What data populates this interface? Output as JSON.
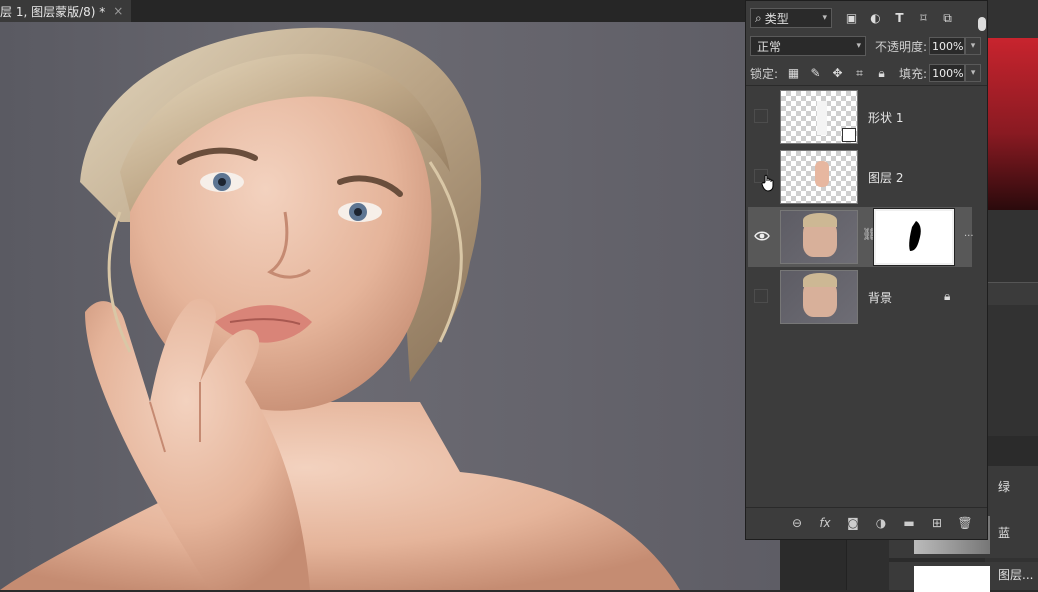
{
  "document": {
    "tab_title": "层 1, 图层蒙版/8) *",
    "close_glyph": "×"
  },
  "layers_panel": {
    "filter": {
      "label": "类型",
      "icon": "search-icon"
    },
    "filter_icons": [
      "image-filter-icon",
      "adjustment-filter-icon",
      "type-filter-icon",
      "shape-filter-icon",
      "smart-object-filter-icon"
    ],
    "blend_mode": "正常",
    "opacity_label": "不透明度:",
    "opacity_value": "100%",
    "lock_label": "锁定:",
    "lock_icons": [
      "lock-transparent-icon",
      "lock-paint-icon",
      "lock-position-icon",
      "lock-artboard-icon",
      "lock-all-icon"
    ],
    "fill_label": "填充:",
    "fill_value": "100%",
    "layers": [
      {
        "name": "形状 1",
        "visible": false,
        "type": "shape"
      },
      {
        "name": "图层 2",
        "visible": false,
        "type": "pixel"
      },
      {
        "name": "",
        "visible": true,
        "type": "masked",
        "selected": true
      },
      {
        "name": "背景",
        "visible": false,
        "type": "background",
        "locked": true
      }
    ],
    "footer_icons": [
      "link-layers-icon",
      "fx-icon",
      "add-mask-icon",
      "adjustment-layer-icon",
      "group-folder-icon",
      "new-layer-icon",
      "trash-icon"
    ]
  },
  "channels": [
    {
      "name": "绿"
    },
    {
      "name": "蓝"
    },
    {
      "name": "图层..."
    }
  ],
  "colors": {
    "panel_bg": "#3c3c3c",
    "selected_row": "#585858",
    "canvas_bg": "#64636b"
  }
}
